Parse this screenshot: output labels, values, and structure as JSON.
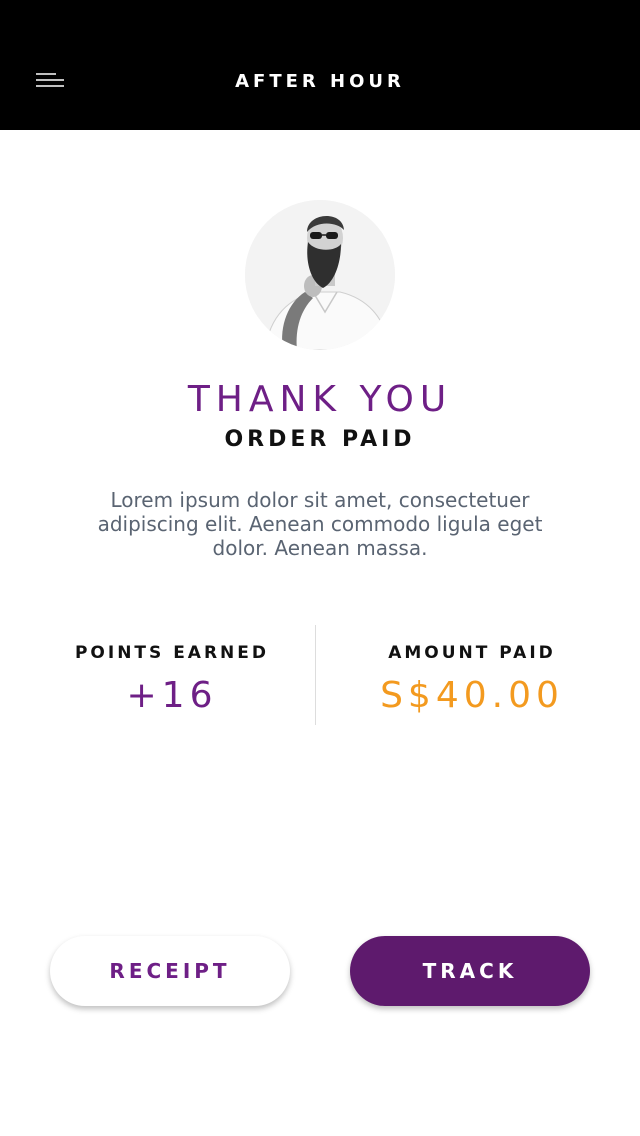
{
  "header": {
    "title": "AFTER HOUR",
    "menu_icon": "hamburger-menu-icon",
    "background": "#000000"
  },
  "profile": {
    "avatar_alt": "bearded man in sunglasses"
  },
  "confirmation": {
    "heading": "THANK YOU",
    "subheading": "ORDER PAID",
    "description": "Lorem ipsum dolor sit amet, consectetuer adipiscing elit. Aenean commodo ligula eget dolor. Aenean massa."
  },
  "stats": {
    "points_label": "POINTS EARNED",
    "points_value": "+16",
    "amount_label": "AMOUNT PAID",
    "amount_value": "S$40.00"
  },
  "actions": {
    "receipt_label": "RECEIPT",
    "track_label": "TRACK"
  },
  "colors": {
    "brand_purple": "#6e1f86",
    "button_purple": "#5e1a6d",
    "amount_orange": "#f39a1f",
    "body_text": "#5a6472"
  }
}
